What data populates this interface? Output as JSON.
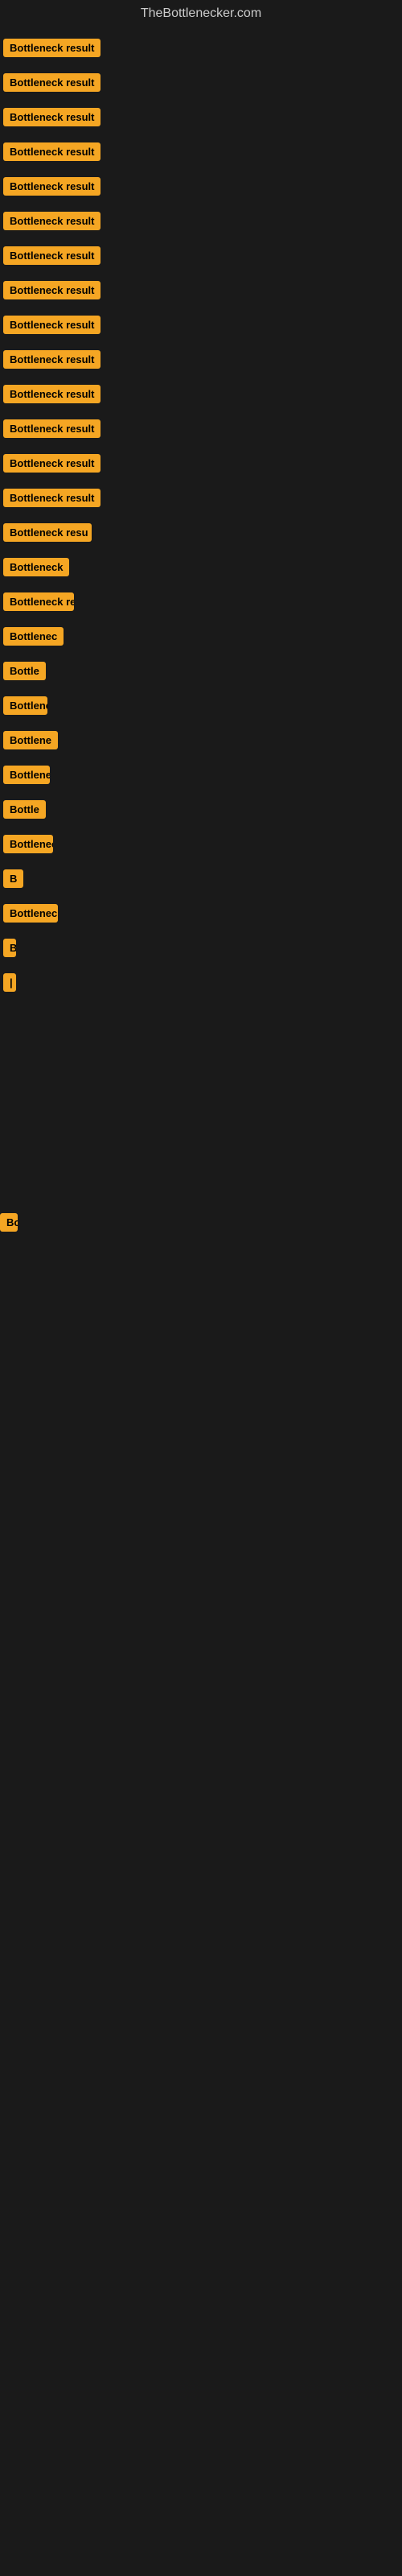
{
  "site": {
    "title": "TheBottlenecker.com"
  },
  "items": [
    {
      "label": "Bottleneck result",
      "visible": true,
      "index": 0
    },
    {
      "label": "Bottleneck result",
      "visible": true,
      "index": 1
    },
    {
      "label": "Bottleneck result",
      "visible": true,
      "index": 2
    },
    {
      "label": "Bottleneck result",
      "visible": true,
      "index": 3
    },
    {
      "label": "Bottleneck result",
      "visible": true,
      "index": 4
    },
    {
      "label": "Bottleneck result",
      "visible": true,
      "index": 5
    },
    {
      "label": "Bottleneck result",
      "visible": true,
      "index": 6
    },
    {
      "label": "Bottleneck result",
      "visible": true,
      "index": 7
    },
    {
      "label": "Bottleneck result",
      "visible": true,
      "index": 8
    },
    {
      "label": "Bottleneck result",
      "visible": true,
      "index": 9
    },
    {
      "label": "Bottleneck result",
      "visible": true,
      "index": 10
    },
    {
      "label": "Bottleneck result",
      "visible": true,
      "index": 11
    },
    {
      "label": "Bottleneck result",
      "visible": true,
      "index": 12
    },
    {
      "label": "Bottleneck result",
      "visible": true,
      "index": 13
    },
    {
      "label": "Bottleneck resu",
      "visible": true,
      "index": 14
    },
    {
      "label": "Bottleneck",
      "visible": true,
      "index": 15
    },
    {
      "label": "Bottleneck res",
      "visible": true,
      "index": 16
    },
    {
      "label": "Bottlenec",
      "visible": true,
      "index": 17
    },
    {
      "label": "Bottle",
      "visible": true,
      "index": 18
    },
    {
      "label": "Bottlenec",
      "visible": true,
      "index": 19
    },
    {
      "label": "Bottlene",
      "visible": true,
      "index": 20
    },
    {
      "label": "Bottleneck r",
      "visible": true,
      "index": 21
    },
    {
      "label": "Bottle",
      "visible": true,
      "index": 22
    },
    {
      "label": "Bottlenec",
      "visible": true,
      "index": 23
    },
    {
      "label": "B",
      "visible": true,
      "index": 24
    },
    {
      "label": "Bottlenec",
      "visible": true,
      "index": 25
    },
    {
      "label": "B",
      "visible": true,
      "index": 26
    },
    {
      "label": "|",
      "visible": true,
      "index": 27
    }
  ],
  "empty_rows": 3,
  "bottom_item": {
    "label": "Bo"
  },
  "colors": {
    "badge_bg": "#f5a623",
    "body_bg": "#1a1a1a",
    "title_color": "#cccccc"
  }
}
